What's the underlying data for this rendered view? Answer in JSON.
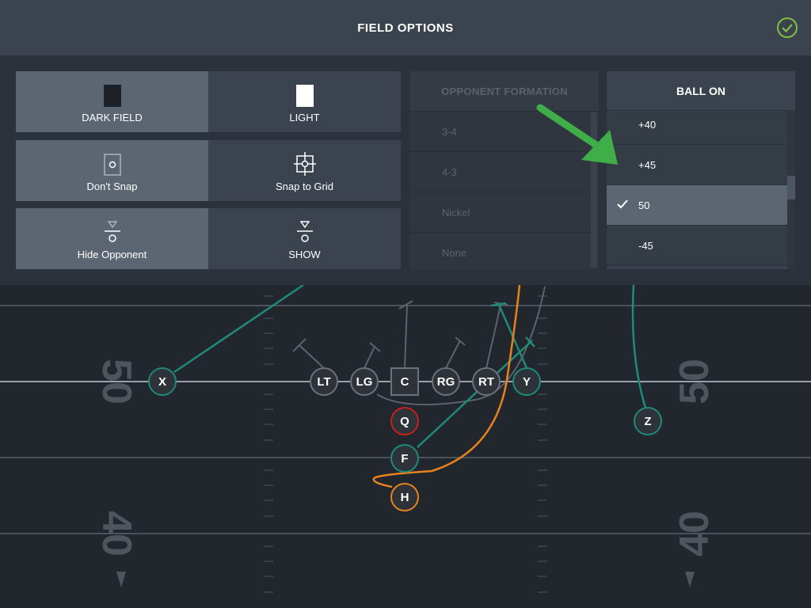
{
  "header": {
    "title": "FIELD OPTIONS",
    "confirm_icon": "check-circle-icon",
    "confirm_color": "#7ec142"
  },
  "toggles": {
    "field_color": {
      "selected": "DARK FIELD",
      "options": [
        "DARK FIELD",
        "LIGHT"
      ]
    },
    "snap": {
      "selected": "Don't Snap",
      "options": [
        "Don't Snap",
        "Snap to Grid"
      ]
    },
    "opponent": {
      "selected": "Hide Opponent",
      "options": [
        "Hide Opponent",
        "SHOW"
      ]
    }
  },
  "opponent_formation": {
    "title": "OPPONENT FORMATION",
    "items": [
      "3-4",
      "4-3",
      "Nickel",
      "None"
    ],
    "disabled": true
  },
  "ball_on": {
    "title": "BALL ON",
    "items": [
      "+40",
      "+45",
      "50",
      "-45"
    ],
    "selected": "50"
  },
  "field": {
    "yard_numbers": [
      "50",
      "50",
      "40",
      "40"
    ],
    "players": [
      {
        "label": "X",
        "color": "green"
      },
      {
        "label": "LT",
        "color": "gray"
      },
      {
        "label": "LG",
        "color": "gray"
      },
      {
        "label": "C",
        "color": "gray"
      },
      {
        "label": "RG",
        "color": "gray"
      },
      {
        "label": "RT",
        "color": "gray"
      },
      {
        "label": "Y",
        "color": "green"
      },
      {
        "label": "Q",
        "color": "red"
      },
      {
        "label": "F",
        "color": "green"
      },
      {
        "label": "H",
        "color": "orange"
      },
      {
        "label": "Z",
        "color": "green"
      }
    ]
  },
  "colors": {
    "route_green": "#1e8a7a",
    "route_orange": "#e8821f",
    "qb_red": "#c7201f",
    "arrow_green": "#3fae49"
  }
}
